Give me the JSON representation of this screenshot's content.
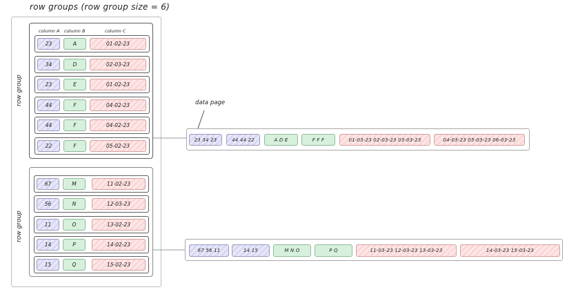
{
  "title": "row groups (row group size = 6)",
  "row_group_label": "row group",
  "columns": [
    "column A",
    "column B",
    "column C"
  ],
  "row_groups": [
    {
      "rows": [
        [
          "23",
          "A",
          "01-02-23"
        ],
        [
          "34",
          "D",
          "02-03-23"
        ],
        [
          "23",
          "E",
          "01-02-23"
        ],
        [
          "44",
          "F",
          "04-02-23"
        ],
        [
          "44",
          "F",
          "04-02-23"
        ],
        [
          "22",
          "F",
          "05-02-23"
        ]
      ]
    },
    {
      "rows": [
        [
          "67",
          "M",
          "11-02-23"
        ],
        [
          "56",
          "N",
          "12-03-23"
        ],
        [
          "11",
          "O",
          "13-02-23"
        ],
        [
          "14",
          "P",
          "14-02-23"
        ],
        [
          "15",
          "Q",
          "15-02-23"
        ]
      ]
    }
  ],
  "data_page_label": "data page",
  "pages": [
    {
      "segments": [
        "23 34 23",
        "44 44 22",
        "A  D  E",
        "F  F  F",
        "01-03-23 02-03-23 03-03-23",
        "04-03-23 05-03-23 06-03-23"
      ]
    },
    {
      "segments": [
        "67 56 11",
        "14 15",
        "M  N  O",
        "P  Q",
        "11-03-23 12-03-23 13-03-23",
        "14-03-23  15-03-23"
      ]
    }
  ],
  "colors": {
    "column_a": "#d8d8f2",
    "column_b": "#d6f0dc",
    "column_c": "#fbd7d7",
    "stroke": "#1e1e1e"
  }
}
